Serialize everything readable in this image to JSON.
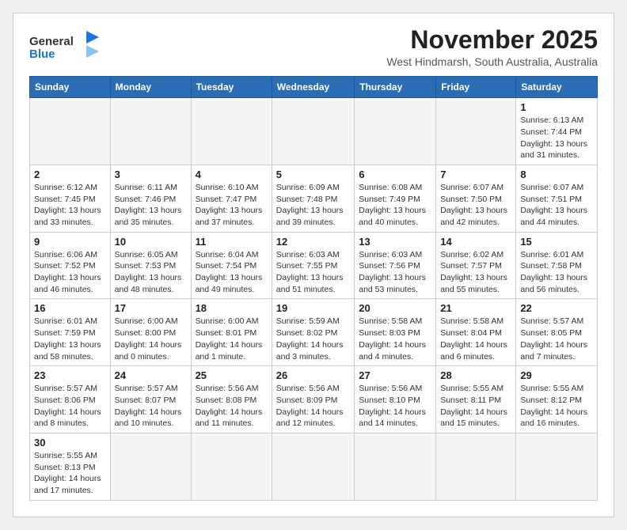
{
  "logo": {
    "text_general": "General",
    "text_blue": "Blue"
  },
  "header": {
    "month": "November 2025",
    "location": "West Hindmarsh, South Australia, Australia"
  },
  "weekdays": [
    "Sunday",
    "Monday",
    "Tuesday",
    "Wednesday",
    "Thursday",
    "Friday",
    "Saturday"
  ],
  "weeks": [
    [
      {
        "day": "",
        "info": ""
      },
      {
        "day": "",
        "info": ""
      },
      {
        "day": "",
        "info": ""
      },
      {
        "day": "",
        "info": ""
      },
      {
        "day": "",
        "info": ""
      },
      {
        "day": "",
        "info": ""
      },
      {
        "day": "1",
        "info": "Sunrise: 6:13 AM\nSunset: 7:44 PM\nDaylight: 13 hours\nand 31 minutes."
      }
    ],
    [
      {
        "day": "2",
        "info": "Sunrise: 6:12 AM\nSunset: 7:45 PM\nDaylight: 13 hours\nand 33 minutes."
      },
      {
        "day": "3",
        "info": "Sunrise: 6:11 AM\nSunset: 7:46 PM\nDaylight: 13 hours\nand 35 minutes."
      },
      {
        "day": "4",
        "info": "Sunrise: 6:10 AM\nSunset: 7:47 PM\nDaylight: 13 hours\nand 37 minutes."
      },
      {
        "day": "5",
        "info": "Sunrise: 6:09 AM\nSunset: 7:48 PM\nDaylight: 13 hours\nand 39 minutes."
      },
      {
        "day": "6",
        "info": "Sunrise: 6:08 AM\nSunset: 7:49 PM\nDaylight: 13 hours\nand 40 minutes."
      },
      {
        "day": "7",
        "info": "Sunrise: 6:07 AM\nSunset: 7:50 PM\nDaylight: 13 hours\nand 42 minutes."
      },
      {
        "day": "8",
        "info": "Sunrise: 6:07 AM\nSunset: 7:51 PM\nDaylight: 13 hours\nand 44 minutes."
      }
    ],
    [
      {
        "day": "9",
        "info": "Sunrise: 6:06 AM\nSunset: 7:52 PM\nDaylight: 13 hours\nand 46 minutes."
      },
      {
        "day": "10",
        "info": "Sunrise: 6:05 AM\nSunset: 7:53 PM\nDaylight: 13 hours\nand 48 minutes."
      },
      {
        "day": "11",
        "info": "Sunrise: 6:04 AM\nSunset: 7:54 PM\nDaylight: 13 hours\nand 49 minutes."
      },
      {
        "day": "12",
        "info": "Sunrise: 6:03 AM\nSunset: 7:55 PM\nDaylight: 13 hours\nand 51 minutes."
      },
      {
        "day": "13",
        "info": "Sunrise: 6:03 AM\nSunset: 7:56 PM\nDaylight: 13 hours\nand 53 minutes."
      },
      {
        "day": "14",
        "info": "Sunrise: 6:02 AM\nSunset: 7:57 PM\nDaylight: 13 hours\nand 55 minutes."
      },
      {
        "day": "15",
        "info": "Sunrise: 6:01 AM\nSunset: 7:58 PM\nDaylight: 13 hours\nand 56 minutes."
      }
    ],
    [
      {
        "day": "16",
        "info": "Sunrise: 6:01 AM\nSunset: 7:59 PM\nDaylight: 13 hours\nand 58 minutes."
      },
      {
        "day": "17",
        "info": "Sunrise: 6:00 AM\nSunset: 8:00 PM\nDaylight: 14 hours\nand 0 minutes."
      },
      {
        "day": "18",
        "info": "Sunrise: 6:00 AM\nSunset: 8:01 PM\nDaylight: 14 hours\nand 1 minute."
      },
      {
        "day": "19",
        "info": "Sunrise: 5:59 AM\nSunset: 8:02 PM\nDaylight: 14 hours\nand 3 minutes."
      },
      {
        "day": "20",
        "info": "Sunrise: 5:58 AM\nSunset: 8:03 PM\nDaylight: 14 hours\nand 4 minutes."
      },
      {
        "day": "21",
        "info": "Sunrise: 5:58 AM\nSunset: 8:04 PM\nDaylight: 14 hours\nand 6 minutes."
      },
      {
        "day": "22",
        "info": "Sunrise: 5:57 AM\nSunset: 8:05 PM\nDaylight: 14 hours\nand 7 minutes."
      }
    ],
    [
      {
        "day": "23",
        "info": "Sunrise: 5:57 AM\nSunset: 8:06 PM\nDaylight: 14 hours\nand 8 minutes."
      },
      {
        "day": "24",
        "info": "Sunrise: 5:57 AM\nSunset: 8:07 PM\nDaylight: 14 hours\nand 10 minutes."
      },
      {
        "day": "25",
        "info": "Sunrise: 5:56 AM\nSunset: 8:08 PM\nDaylight: 14 hours\nand 11 minutes."
      },
      {
        "day": "26",
        "info": "Sunrise: 5:56 AM\nSunset: 8:09 PM\nDaylight: 14 hours\nand 12 minutes."
      },
      {
        "day": "27",
        "info": "Sunrise: 5:56 AM\nSunset: 8:10 PM\nDaylight: 14 hours\nand 14 minutes."
      },
      {
        "day": "28",
        "info": "Sunrise: 5:55 AM\nSunset: 8:11 PM\nDaylight: 14 hours\nand 15 minutes."
      },
      {
        "day": "29",
        "info": "Sunrise: 5:55 AM\nSunset: 8:12 PM\nDaylight: 14 hours\nand 16 minutes."
      }
    ],
    [
      {
        "day": "30",
        "info": "Sunrise: 5:55 AM\nSunset: 8:13 PM\nDaylight: 14 hours\nand 17 minutes."
      },
      {
        "day": "",
        "info": ""
      },
      {
        "day": "",
        "info": ""
      },
      {
        "day": "",
        "info": ""
      },
      {
        "day": "",
        "info": ""
      },
      {
        "day": "",
        "info": ""
      },
      {
        "day": "",
        "info": ""
      }
    ]
  ]
}
